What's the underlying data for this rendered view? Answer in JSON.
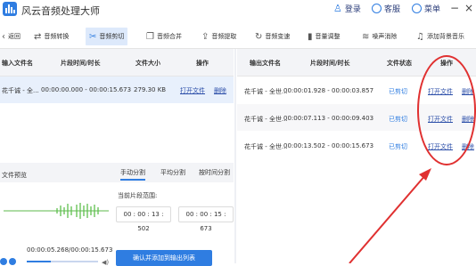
{
  "app": {
    "title": "风云音频处理大师",
    "login": "登录",
    "support": "客服",
    "menu": "菜单"
  },
  "toolbar": {
    "back": "返回",
    "items": [
      "音频转换",
      "音频剪切",
      "音频合并",
      "音频提取",
      "音频变速",
      "音量调整",
      "噪声消除",
      "添加背景音乐"
    ],
    "active_index": 1
  },
  "input_table": {
    "headers": [
      "输入文件名",
      "片段时间/时长",
      "文件大小",
      "操作"
    ],
    "rows": [
      {
        "name": "花千诚 - 全...",
        "time": "00:00:00.000 - 00:00:15.673",
        "size": "279.30 KB",
        "open": "打开文件",
        "delete": "删除"
      }
    ]
  },
  "output_table": {
    "headers": [
      "输出文件名",
      "片段时间/时长",
      "文件状态",
      "操作"
    ],
    "rows": [
      {
        "name": "花千诚 - 全世...",
        "time": "00:00:01.928 - 00:00:03.857",
        "status": "已剪切",
        "open": "打开文件",
        "delete": "删除"
      },
      {
        "name": "花千诚 - 全世...",
        "time": "00:00:07.113 - 00:00:09.403",
        "status": "已剪切",
        "open": "打开文件",
        "delete": "删除"
      },
      {
        "name": "花千诚 - 全世...",
        "time": "00:00:13.502 - 00:00:15.673",
        "status": "已剪切",
        "open": "打开文件",
        "delete": "删除"
      }
    ]
  },
  "preview": {
    "label": "文件预览",
    "tabs": [
      "手动分割",
      "平均分割",
      "按时间分割"
    ],
    "active_tab": 0,
    "segment_label": "当前片段范围:",
    "start_time": "00 : 00 : 13 : 502",
    "end_time": "00 : 00 : 15 : 673",
    "playback_time": "00:00:05.268/00:00:15.673",
    "confirm_button": "确认并添加到输出列表"
  },
  "colors": {
    "accent": "#2f7de1",
    "annotation": "#e03030",
    "header_bg": "#f3f4f7"
  }
}
